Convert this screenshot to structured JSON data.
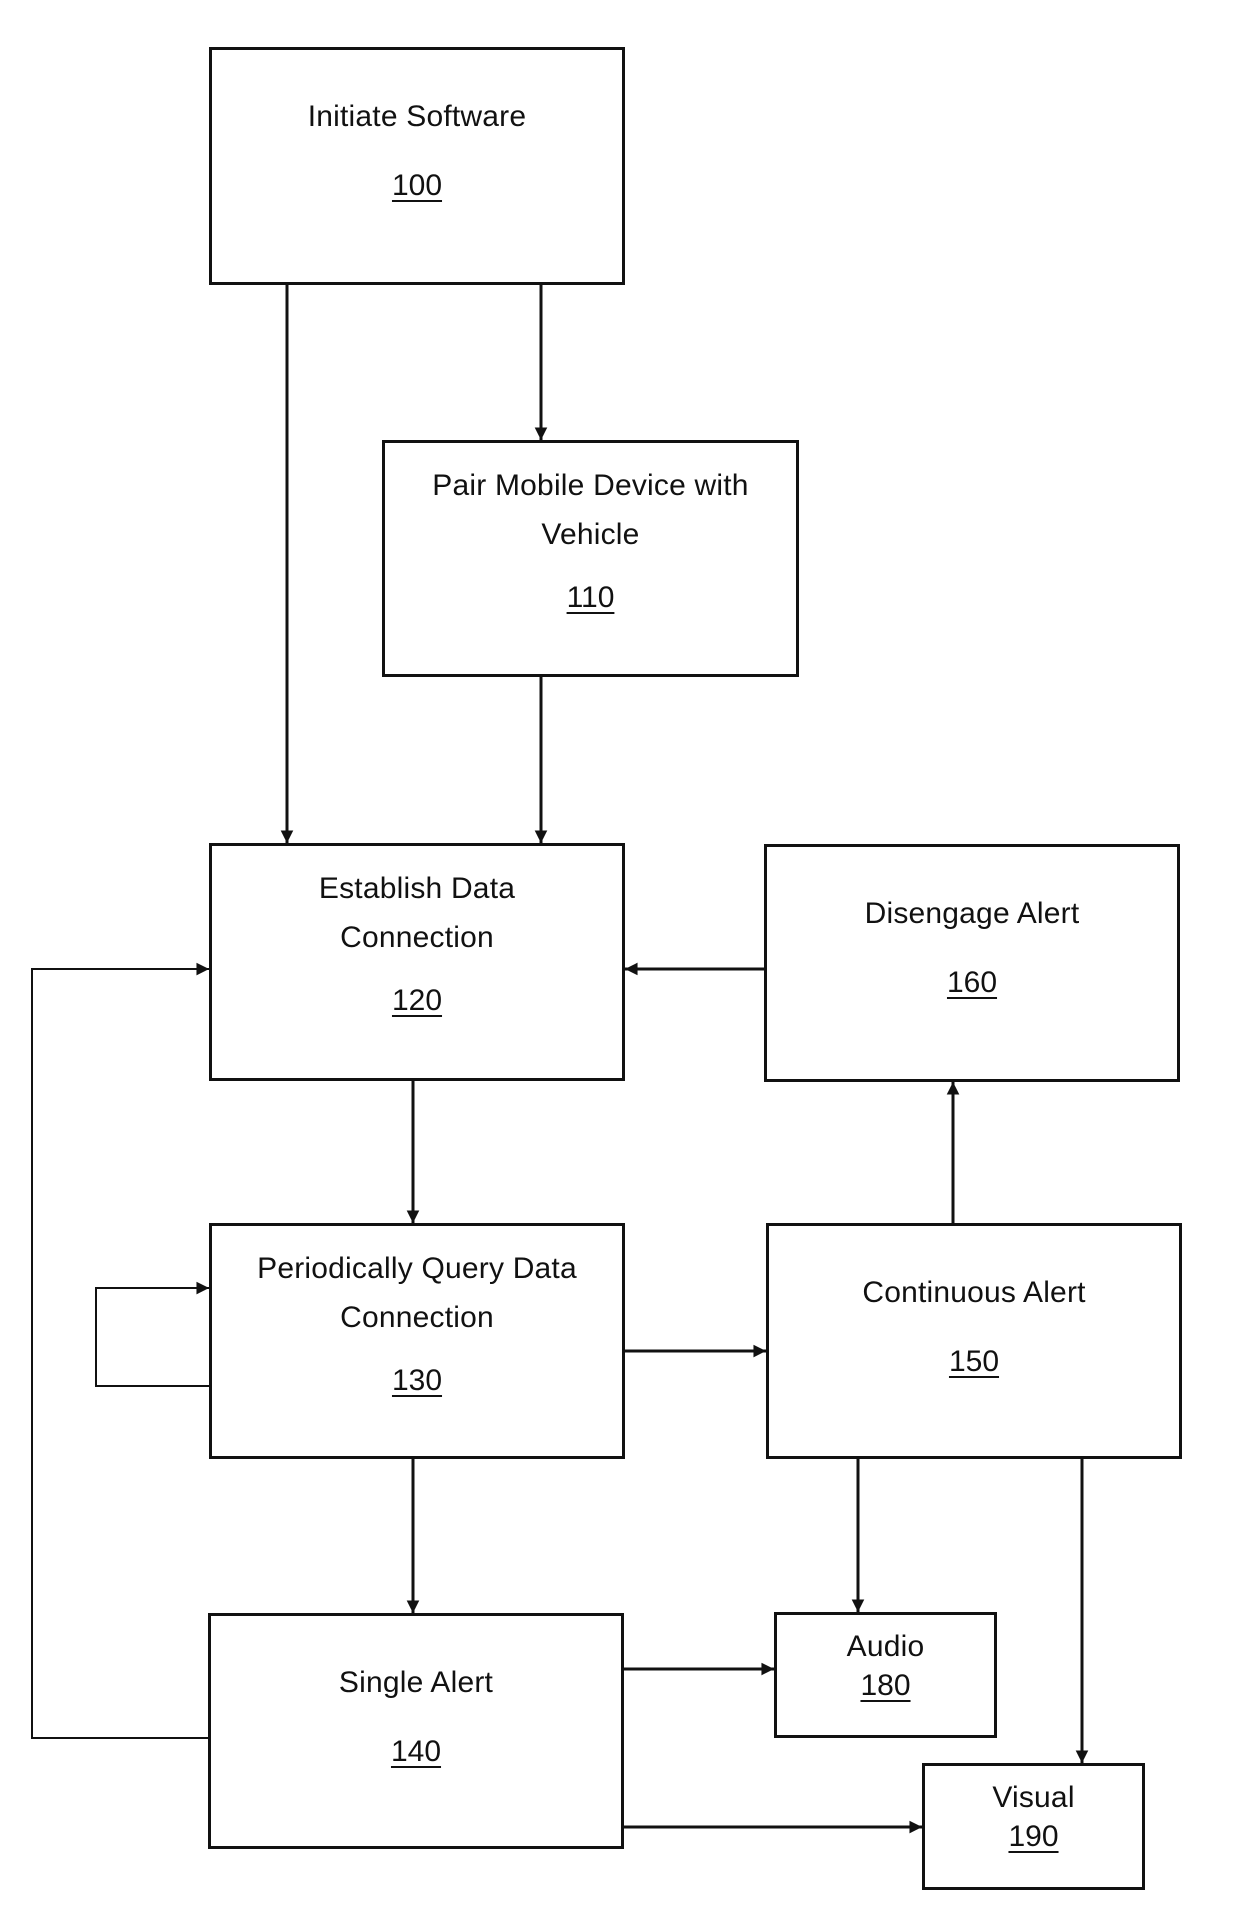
{
  "diagram": {
    "type": "flowchart",
    "nodes": [
      {
        "id": "100",
        "label": "Initiate Software",
        "ref": "100"
      },
      {
        "id": "110",
        "label": "Pair Mobile Device with Vehicle",
        "ref": "110"
      },
      {
        "id": "120",
        "label": "Establish Data Connection",
        "ref": "120"
      },
      {
        "id": "130",
        "label": "Periodically Query Data Connection",
        "ref": "130"
      },
      {
        "id": "140",
        "label": "Single Alert",
        "ref": "140"
      },
      {
        "id": "150",
        "label": "Continuous Alert",
        "ref": "150"
      },
      {
        "id": "160",
        "label": "Disengage Alert",
        "ref": "160"
      },
      {
        "id": "180",
        "label": "Audio",
        "ref": "180"
      },
      {
        "id": "190",
        "label": "Visual",
        "ref": "190"
      }
    ],
    "edges": [
      {
        "from": "100",
        "to": "110"
      },
      {
        "from": "100",
        "to": "120"
      },
      {
        "from": "110",
        "to": "120"
      },
      {
        "from": "160",
        "to": "120"
      },
      {
        "from": "140",
        "to": "120"
      },
      {
        "from": "120",
        "to": "130"
      },
      {
        "from": "130",
        "to": "130"
      },
      {
        "from": "130",
        "to": "150"
      },
      {
        "from": "130",
        "to": "140"
      },
      {
        "from": "150",
        "to": "160"
      },
      {
        "from": "150",
        "to": "180"
      },
      {
        "from": "150",
        "to": "190"
      },
      {
        "from": "140",
        "to": "180"
      },
      {
        "from": "140",
        "to": "190"
      }
    ]
  },
  "boxes": {
    "n100": {
      "line1": "Initiate Software",
      "ref": "100"
    },
    "n110": {
      "line1": "Pair Mobile Device with",
      "line2": "Vehicle",
      "ref": "110"
    },
    "n120": {
      "line1": "Establish Data",
      "line2": "Connection",
      "ref": "120"
    },
    "n130": {
      "line1": "Periodically Query Data",
      "line2": "Connection",
      "ref": "130"
    },
    "n140": {
      "line1": "Single Alert",
      "ref": "140"
    },
    "n150": {
      "line1": "Continuous Alert",
      "ref": "150"
    },
    "n160": {
      "line1": "Disengage Alert",
      "ref": "160"
    },
    "n180": {
      "line1": "Audio",
      "ref": "180"
    },
    "n190": {
      "line1": "Visual",
      "ref": "190"
    }
  }
}
